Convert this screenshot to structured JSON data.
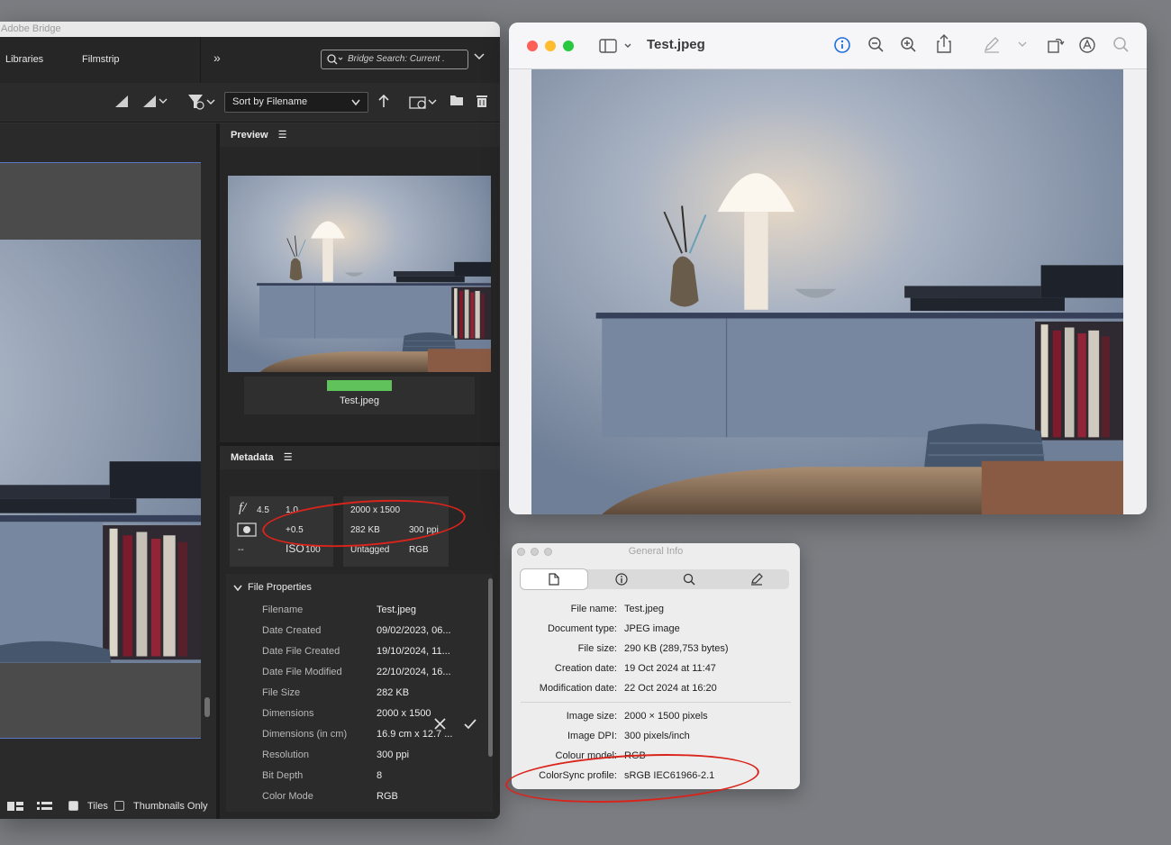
{
  "bridge": {
    "app_title": "Adobe Bridge",
    "tabs": [
      "Libraries",
      "Filmstrip"
    ],
    "search_placeholder": "Bridge Search: Current .",
    "sort_label": "Sort by Filename",
    "preview_panel_title": "Preview",
    "preview_filename": "Test.jpeg",
    "metadata_panel_title": "Metadata",
    "metadata_placard": {
      "aperture": "4.5",
      "shutter": "1.0",
      "exposure_comp": "+0.5",
      "iso_label": "ISO",
      "iso_value": "100",
      "dash": "--",
      "dimensions": "2000 x 1500",
      "file_size": "282 KB",
      "resolution": "300 ppi",
      "color_profile": "Untagged",
      "color_mode": "RGB"
    },
    "file_properties_title": "File Properties",
    "file_properties": [
      {
        "key": "Filename",
        "value": "Test.jpeg"
      },
      {
        "key": "Date Created",
        "value": "09/02/2023, 06..."
      },
      {
        "key": "Date File Created",
        "value": "19/10/2024, 11..."
      },
      {
        "key": "Date File Modified",
        "value": "22/10/2024, 16..."
      },
      {
        "key": "File Size",
        "value": "282 KB"
      },
      {
        "key": "Dimensions",
        "value": "2000 x 1500"
      },
      {
        "key": "Dimensions (in cm)",
        "value": "16.9 cm x 12.7 ..."
      },
      {
        "key": "Resolution",
        "value": "300 ppi"
      },
      {
        "key": "Bit Depth",
        "value": "8"
      },
      {
        "key": "Color Mode",
        "value": "RGB"
      }
    ],
    "bottom_bar": {
      "tiles_label": "Tiles",
      "tiles_checked": true,
      "thumbnails_only_label": "Thumbnails Only",
      "thumbnails_only_checked": false
    },
    "accent_label_color": "#5fc25a"
  },
  "preview_window": {
    "title": "Test.jpeg"
  },
  "general_info": {
    "title": "General Info",
    "rows_top": [
      {
        "key": "File name:",
        "value": "Test.jpeg"
      },
      {
        "key": "Document type:",
        "value": "JPEG image"
      },
      {
        "key": "File size:",
        "value": "290 KB (289,753 bytes)"
      },
      {
        "key": "Creation date:",
        "value": "19 Oct 2024 at 11:47"
      },
      {
        "key": "Modification date:",
        "value": "22 Oct 2024 at 16:20"
      }
    ],
    "rows_bottom": [
      {
        "key": "Image size:",
        "value": "2000 × 1500 pixels"
      },
      {
        "key": "Image DPI:",
        "value": "300 pixels/inch"
      },
      {
        "key": "Colour model:",
        "value": "RGB"
      },
      {
        "key": "ColorSync profile:",
        "value": "sRGB IEC61966-2.1"
      }
    ]
  },
  "annotation_color": "#d9241c"
}
